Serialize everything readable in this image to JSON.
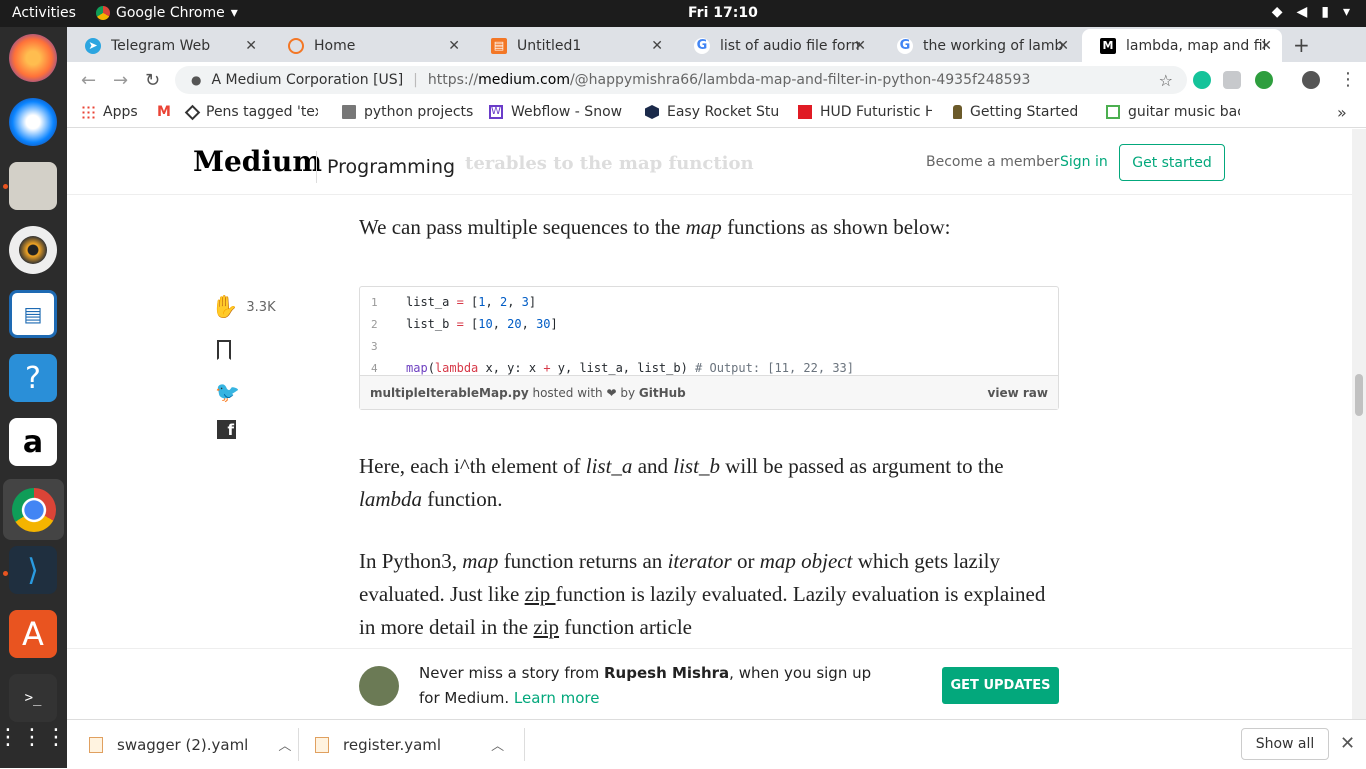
{
  "os": {
    "activities": "Activities",
    "app_name": "Google Chrome",
    "clock": "Fri 17:10"
  },
  "tabs": [
    {
      "label": "Telegram Web",
      "icon": "telegram-icon",
      "color": "#2ca5e0"
    },
    {
      "label": "Home",
      "icon": "jupyter-icon",
      "color": "#f37726"
    },
    {
      "label": "Untitled1",
      "icon": "notebook-icon",
      "color": "#f37726"
    },
    {
      "label": "list of audio file form",
      "icon": "google-icon",
      "color": "#4285f4"
    },
    {
      "label": "the working of lamb",
      "icon": "google-icon",
      "color": "#4285f4"
    },
    {
      "label": "lambda, map and fil",
      "icon": "medium-icon",
      "color": "#000000",
      "active": true
    }
  ],
  "omnibox": {
    "org": "A Medium Corporation [US]",
    "scheme": "https://",
    "domain": "medium.com",
    "path": "/@happymishra66/lambda-map-and-filter-in-python-4935f248593"
  },
  "bookmarks": [
    {
      "label": "Apps"
    },
    {
      "label": ""
    },
    {
      "label": "Pens tagged 'tex"
    },
    {
      "label": "python projects"
    },
    {
      "label": "Webflow - Snow"
    },
    {
      "label": "Easy Rocket Stuc"
    },
    {
      "label": "HUD Futuristic H"
    },
    {
      "label": "Getting Started"
    },
    {
      "label": "guitar music bac"
    }
  ],
  "medium": {
    "logo": "Medium",
    "section": "Programming",
    "ghost_heading": "terables to the map function",
    "become": "Become a member",
    "signin": "Sign in",
    "get_started": "Get started",
    "claps": "3.3K"
  },
  "article": {
    "p1_a": "We can pass multiple sequences to the ",
    "p1_em": "map",
    "p1_b": " functions as shown below:",
    "p2_a": "Here, each i^th element of ",
    "p2_em1": "list_a",
    "p2_b": " and ",
    "p2_em2": "list_b",
    "p2_c": " will be passed as argument to the ",
    "p2_em3": "lambda",
    "p2_d": " function.",
    "p3_a": "In Python3, ",
    "p3_em1": "map",
    "p3_b": " function returns an ",
    "p3_em2": "iterator",
    "p3_c": " or ",
    "p3_em3": "map object",
    "p3_d": " which gets lazily evaluated. Just like ",
    "p3_link1": "zip ",
    "p3_e": "function is lazily evaluated. Lazily evaluation is explained in more detail in the ",
    "p3_link2": "zip",
    "p3_f": " function article"
  },
  "gist": {
    "filename": "multipleIterableMap.py",
    "hosted": " hosted with ❤ by ",
    "github": "GitHub",
    "view_raw": "view raw",
    "lines": [
      "1",
      "2",
      "3",
      "4"
    ]
  },
  "footer": {
    "never_a": "Never miss a story from ",
    "author": "Rupesh Mishra",
    "never_b": ", when you sign up for Medium. ",
    "learn_more": "Learn more",
    "get_updates": "GET UPDATES"
  },
  "downloads": {
    "file1": "swagger (2).yaml",
    "file2": "register.yaml",
    "show_all": "Show all"
  },
  "colors": {
    "medium_green": "#03a87c",
    "ubuntu_orange": "#e95420"
  }
}
